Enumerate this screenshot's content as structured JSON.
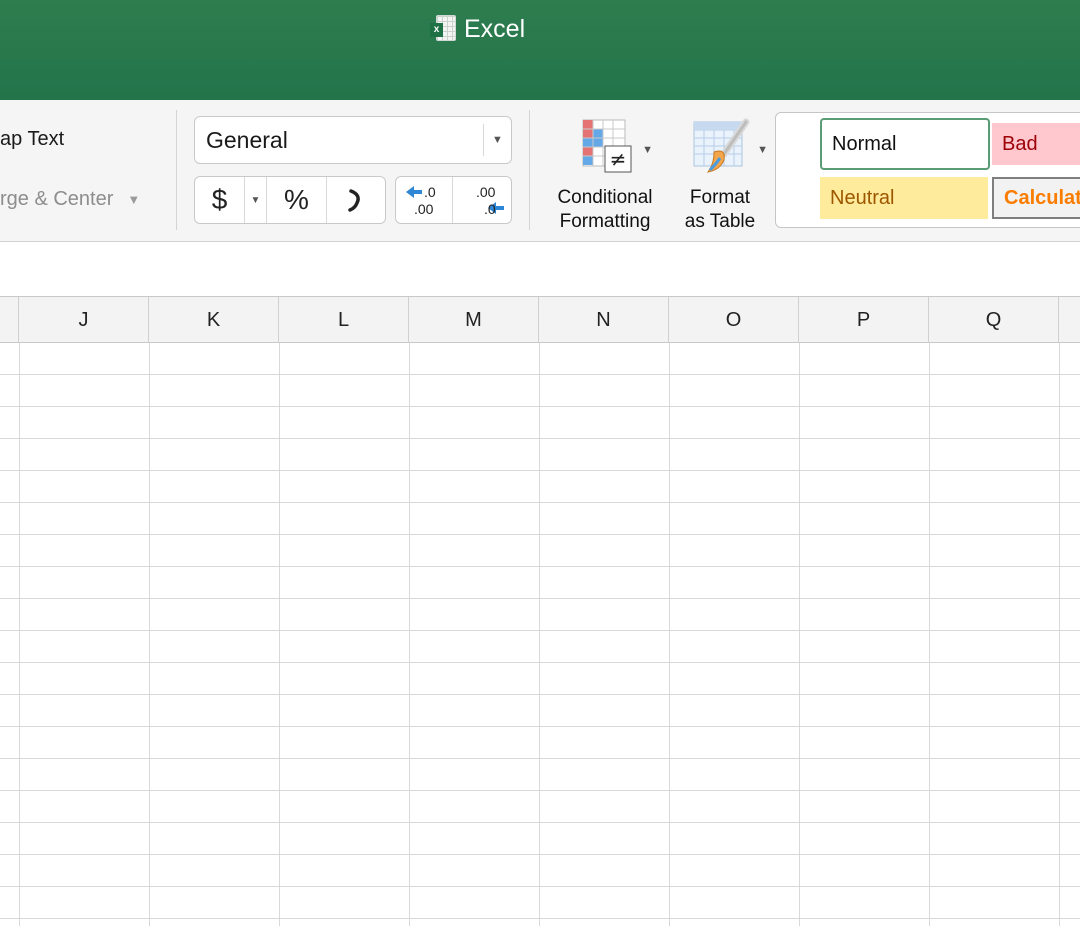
{
  "titlebar": {
    "app_name": "Excel",
    "icon": "excel-document-icon",
    "color": "#23744a"
  },
  "ribbon": {
    "alignment": {
      "wrap_text_label": "ap Text",
      "merge_center_label": "rge & Center"
    },
    "number": {
      "format_value": "General",
      "currency_label": "$",
      "percent_label": "%",
      "comma_label": "ʼ",
      "increase_decimal": {
        "top": ".0",
        "bottom": ".00"
      },
      "decrease_decimal": {
        "top": ".00",
        "bottom": ".0"
      }
    },
    "conditional_formatting": {
      "line1": "Conditional",
      "line2": "Formatting"
    },
    "format_as_table": {
      "line1": "Format",
      "line2": "as Table"
    },
    "cell_styles": {
      "normal": "Normal",
      "bad": "Bad",
      "neutral": "Neutral",
      "calculation": "Calculat"
    }
  },
  "grid": {
    "columns": [
      "J",
      "K",
      "L",
      "M",
      "N",
      "O",
      "P",
      "Q"
    ]
  }
}
